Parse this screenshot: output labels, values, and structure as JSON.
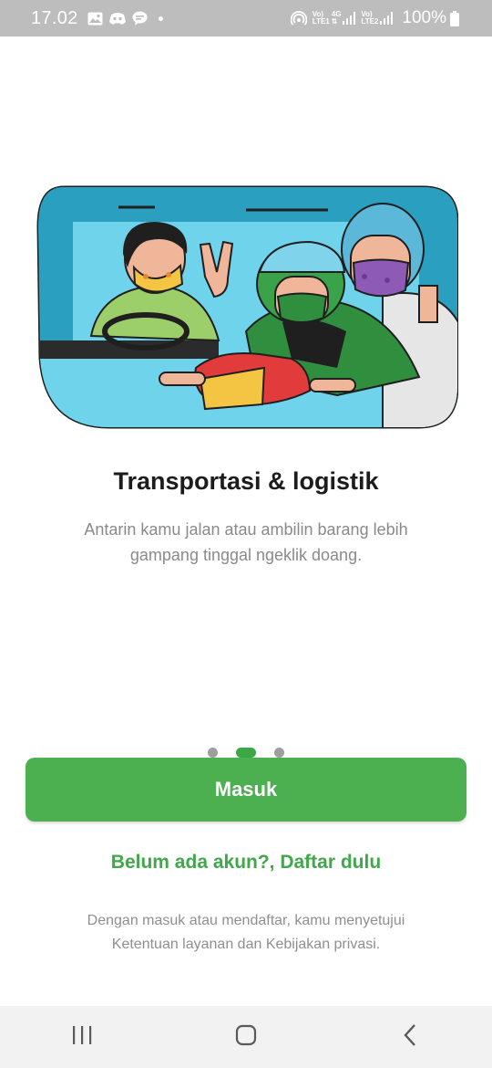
{
  "status_bar": {
    "time": "17.02",
    "icons": [
      "gallery-icon",
      "discord-icon",
      "chat-icon",
      "notification-dot",
      "hotspot-icon"
    ],
    "sim1_label_top": "Vo)",
    "sim1_label_bottom": "LTE1",
    "network_type": "4G",
    "sim2_label_top": "Vo)",
    "sim2_label_bottom": "LTE2",
    "battery": "100%"
  },
  "onboarding": {
    "illustration": "transport-illustration",
    "title": "Transportasi & logistik",
    "description": "Antarin kamu jalan atau ambilin barang lebih gampang tinggal ngeklik doang.",
    "pager": {
      "total": 3,
      "active_index": 1
    }
  },
  "actions": {
    "login_label": "Masuk",
    "register_label": "Belum ada akun?, Daftar dulu",
    "terms_text": "Dengan masuk atau mendaftar, kamu menyetujui Ketentuan layanan dan Kebijakan privasi."
  },
  "colors": {
    "primary": "#4caf50",
    "link": "#3fa949",
    "status_bar": "#bdbdbd"
  },
  "nav_bar": {
    "buttons": [
      "recent-apps-icon",
      "home-icon",
      "back-icon"
    ]
  }
}
